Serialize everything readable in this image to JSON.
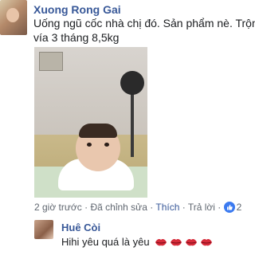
{
  "post": {
    "author": "Xuong Rong Gai",
    "text_line1": "Uống ngũ cốc nhà chị đó. Sản phẩm nè. Trộm",
    "text_line2": "vía 3 tháng 8,5kg",
    "meta": {
      "time": "2 giờ trước",
      "edited": "Đã chỉnh sửa",
      "like": "Thích",
      "reply": "Trả lời",
      "reaction_count": "2"
    }
  },
  "reply": {
    "author": "Huê Còi",
    "text": "Hihi yêu quá là yêu",
    "emoji_count": 4,
    "icon": "kiss-lips-icon",
    "lips_color": "#d62b3a"
  },
  "colors": {
    "link": "#385898",
    "meta_text": "#606770",
    "like_badge": "#3b7af0"
  }
}
